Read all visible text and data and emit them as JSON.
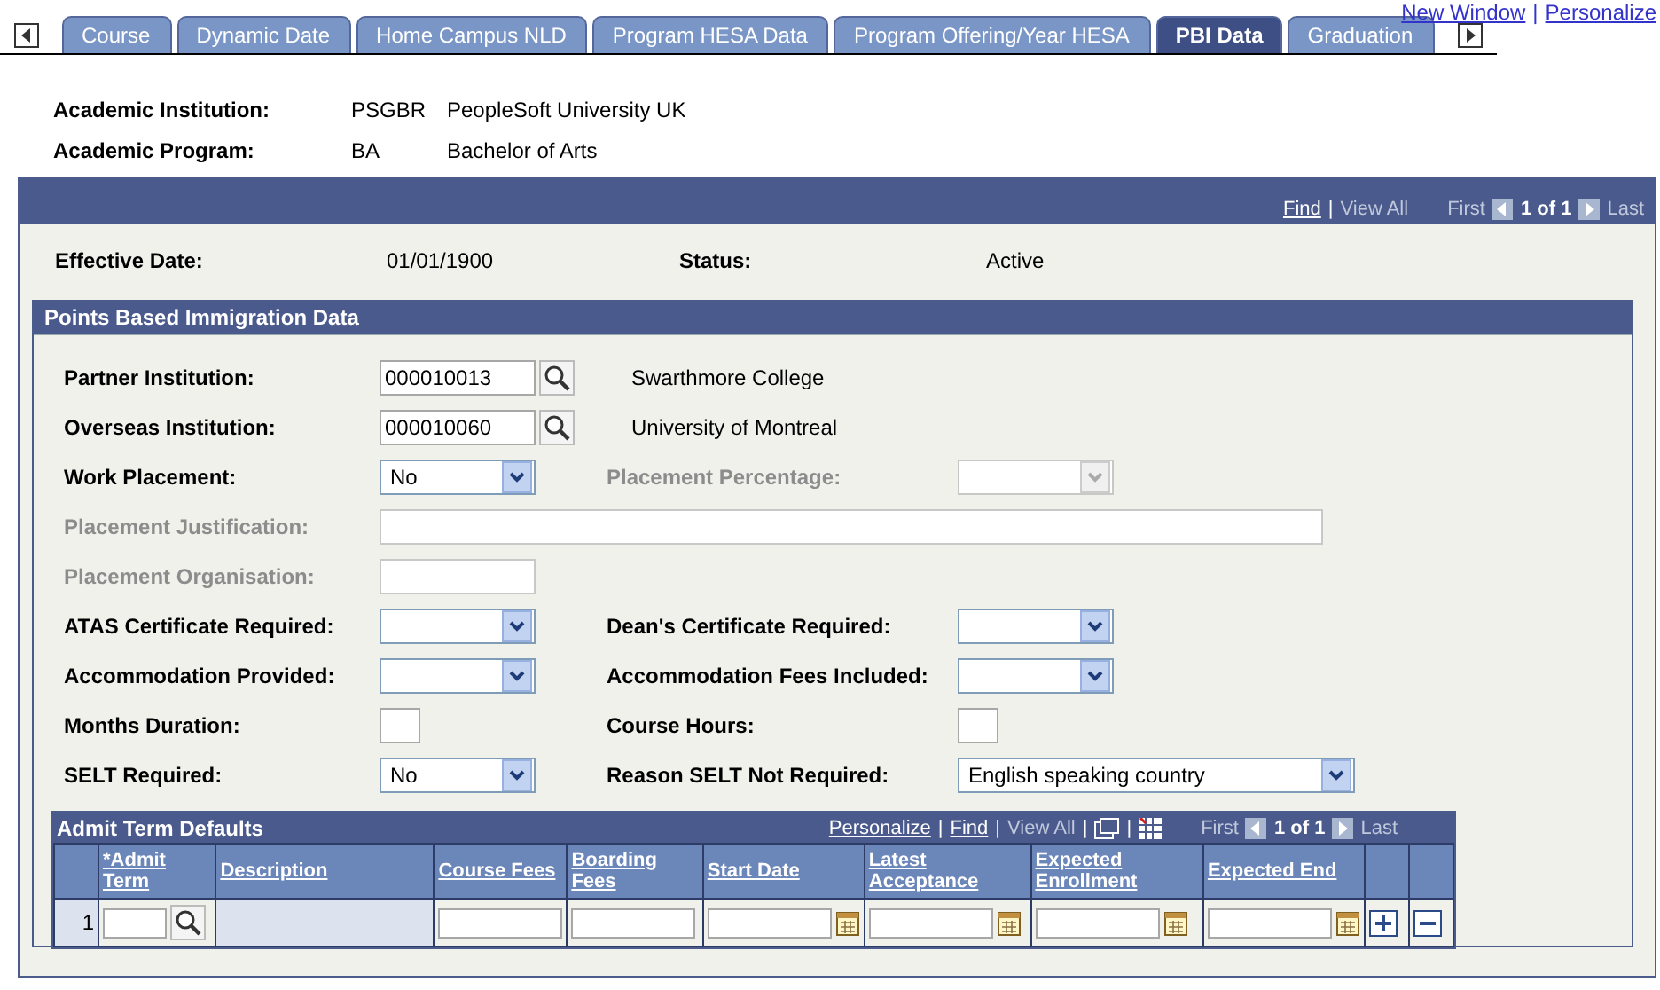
{
  "top_links": {
    "items": [
      "New Window",
      "Personalize"
    ],
    "separator": "|"
  },
  "tabs": [
    {
      "label": "Course",
      "selected": false
    },
    {
      "label": "Dynamic Date",
      "selected": false
    },
    {
      "label": "Home Campus NLD",
      "selected": false
    },
    {
      "label": "Program HESA Data",
      "selected": false
    },
    {
      "label": "Program Offering/Year HESA",
      "selected": false
    },
    {
      "label": "PBI Data",
      "selected": true
    },
    {
      "label": "Graduation",
      "selected": false
    }
  ],
  "header": [
    {
      "label": "Academic Institution:",
      "code": "PSGBR",
      "description": "PeopleSoft University UK"
    },
    {
      "label": "Academic Program:",
      "code": "BA",
      "description": "Bachelor of  Arts"
    }
  ],
  "panel": {
    "nav": {
      "find": "Find",
      "separator": "|",
      "view_all": "View All",
      "first": "First",
      "count": "1 of 1",
      "last": "Last"
    },
    "effective_date_label": "Effective Date:",
    "effective_date": "01/01/1900",
    "status_label": "Status:",
    "status": "Active"
  },
  "section": {
    "title": "Points Based Immigration Data",
    "rows": [
      {
        "fields": [
          {
            "label": "Partner Institution:",
            "kind": "lookup",
            "value": "000010013",
            "description": "Swarthmore College",
            "disabled": false
          }
        ]
      },
      {
        "fields": [
          {
            "label": "Overseas Institution:",
            "kind": "lookup",
            "value": "000010060",
            "description": "University of Montreal",
            "disabled": false
          }
        ]
      },
      {
        "fields": [
          {
            "label": "Work Placement:",
            "kind": "dropdown",
            "value": "No",
            "disabled": false
          },
          {
            "label": "Placement Percentage:",
            "kind": "dropdown-small",
            "disabled": true
          }
        ]
      },
      {
        "fields": [
          {
            "label": "Placement Justification:",
            "kind": "wide-input",
            "disabled": true
          }
        ]
      },
      {
        "fields": [
          {
            "label": "Placement Organisation:",
            "kind": "input",
            "disabled": true
          }
        ]
      },
      {
        "fields": [
          {
            "label": "ATAS Certificate Required:",
            "kind": "dropdown",
            "disabled": false
          },
          {
            "label": "Dean's Certificate Required:",
            "kind": "dropdown-small",
            "disabled": false
          }
        ]
      },
      {
        "fields": [
          {
            "label": "Accommodation Provided:",
            "kind": "dropdown",
            "disabled": false
          },
          {
            "label": "Accommodation Fees Included:",
            "kind": "dropdown-small",
            "disabled": false
          }
        ]
      },
      {
        "fields": [
          {
            "label": "Months Duration:",
            "kind": "tiny-input",
            "disabled": false
          },
          {
            "label": "Course Hours:",
            "kind": "tiny-input",
            "disabled": false
          }
        ]
      },
      {
        "fields": [
          {
            "label": "SELT Required:",
            "kind": "dropdown",
            "value": "No",
            "disabled": false
          },
          {
            "label": "Reason SELT Not Required:",
            "kind": "dropdown-wide",
            "value": "English speaking country",
            "disabled": false
          }
        ]
      }
    ]
  },
  "grid": {
    "title": "Admit Term Defaults",
    "links": {
      "personalize": "Personalize",
      "separator": "|",
      "find": "Find",
      "view_all": "View All",
      "first": "First",
      "count": "1 of 1",
      "last": "Last"
    },
    "columns": [
      {
        "label": "*Admit Term",
        "kind": "lookup"
      },
      {
        "label": "Description",
        "kind": "display"
      },
      {
        "label": "Course Fees",
        "kind": "input"
      },
      {
        "label": "Boarding Fees",
        "kind": "input"
      },
      {
        "label": "Start Date",
        "kind": "date"
      },
      {
        "label": "Latest Acceptance",
        "kind": "date"
      },
      {
        "label": "Expected Enrollment",
        "kind": "date"
      },
      {
        "label": "Expected End",
        "kind": "date"
      }
    ],
    "rows": [
      {
        "number": "1"
      }
    ]
  }
}
